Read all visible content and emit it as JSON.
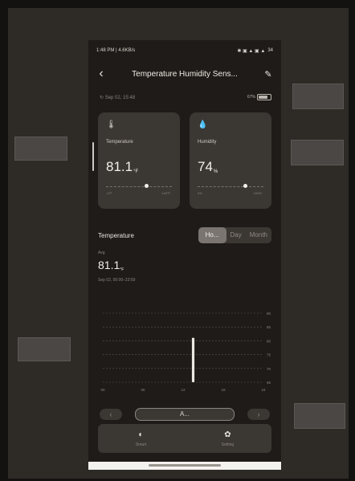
{
  "status_bar": {
    "left": "1:48 PM | 4.6KB/s",
    "right_icons": "✱ ▣ ▲ ▣ ▲",
    "battery": "34"
  },
  "header": {
    "title": "Temperature Humidity Sens...",
    "back_icon": "‹",
    "edit_icon": "✎"
  },
  "sync": {
    "timestamp": "Sep 02, 15:48",
    "battery_label": "67%"
  },
  "cards": [
    {
      "label": "Temperature",
      "value": "81.1",
      "unit": "°F",
      "range_min": "-4°F",
      "range_max": "140°F",
      "icon": "thermometer-icon",
      "glyph": "🌡",
      "level": 0.62
    },
    {
      "label": "Humidity",
      "value": "74",
      "unit": "%",
      "range_min": "0%",
      "range_max": "100%",
      "icon": "droplets-icon",
      "glyph": "💧",
      "level": 0.72
    }
  ],
  "section": {
    "title": "Temperature",
    "tabs": [
      "Ho...",
      "Day",
      "Month"
    ],
    "active_tab": 0
  },
  "summary": {
    "avg_label": "Avg",
    "avg_value": "81.1",
    "avg_unit": "°F",
    "date_range": "Sep 02, 00:00–23:59"
  },
  "chart_data": {
    "type": "bar",
    "x_ticks": [
      "00",
      "06",
      "12",
      "18",
      "24"
    ],
    "y_ticks": [
      "90",
      "85",
      "80",
      "75",
      "70",
      "65"
    ],
    "ylim": [
      65,
      90
    ],
    "series": [
      {
        "x": 13.5,
        "value": 81.1
      }
    ],
    "grid": true
  },
  "date_nav": {
    "prev_icon": "‹",
    "next_icon": "›",
    "center_label": "A..."
  },
  "bottom_nav": [
    {
      "label": "Smart",
      "icon": "smart-icon",
      "glyph": "◐"
    },
    {
      "label": "Setting",
      "icon": "gear-icon",
      "glyph": "✿"
    }
  ],
  "colors": {
    "background": "#1e1b18",
    "card": "#3b3733",
    "accent": "#f3efe9"
  }
}
